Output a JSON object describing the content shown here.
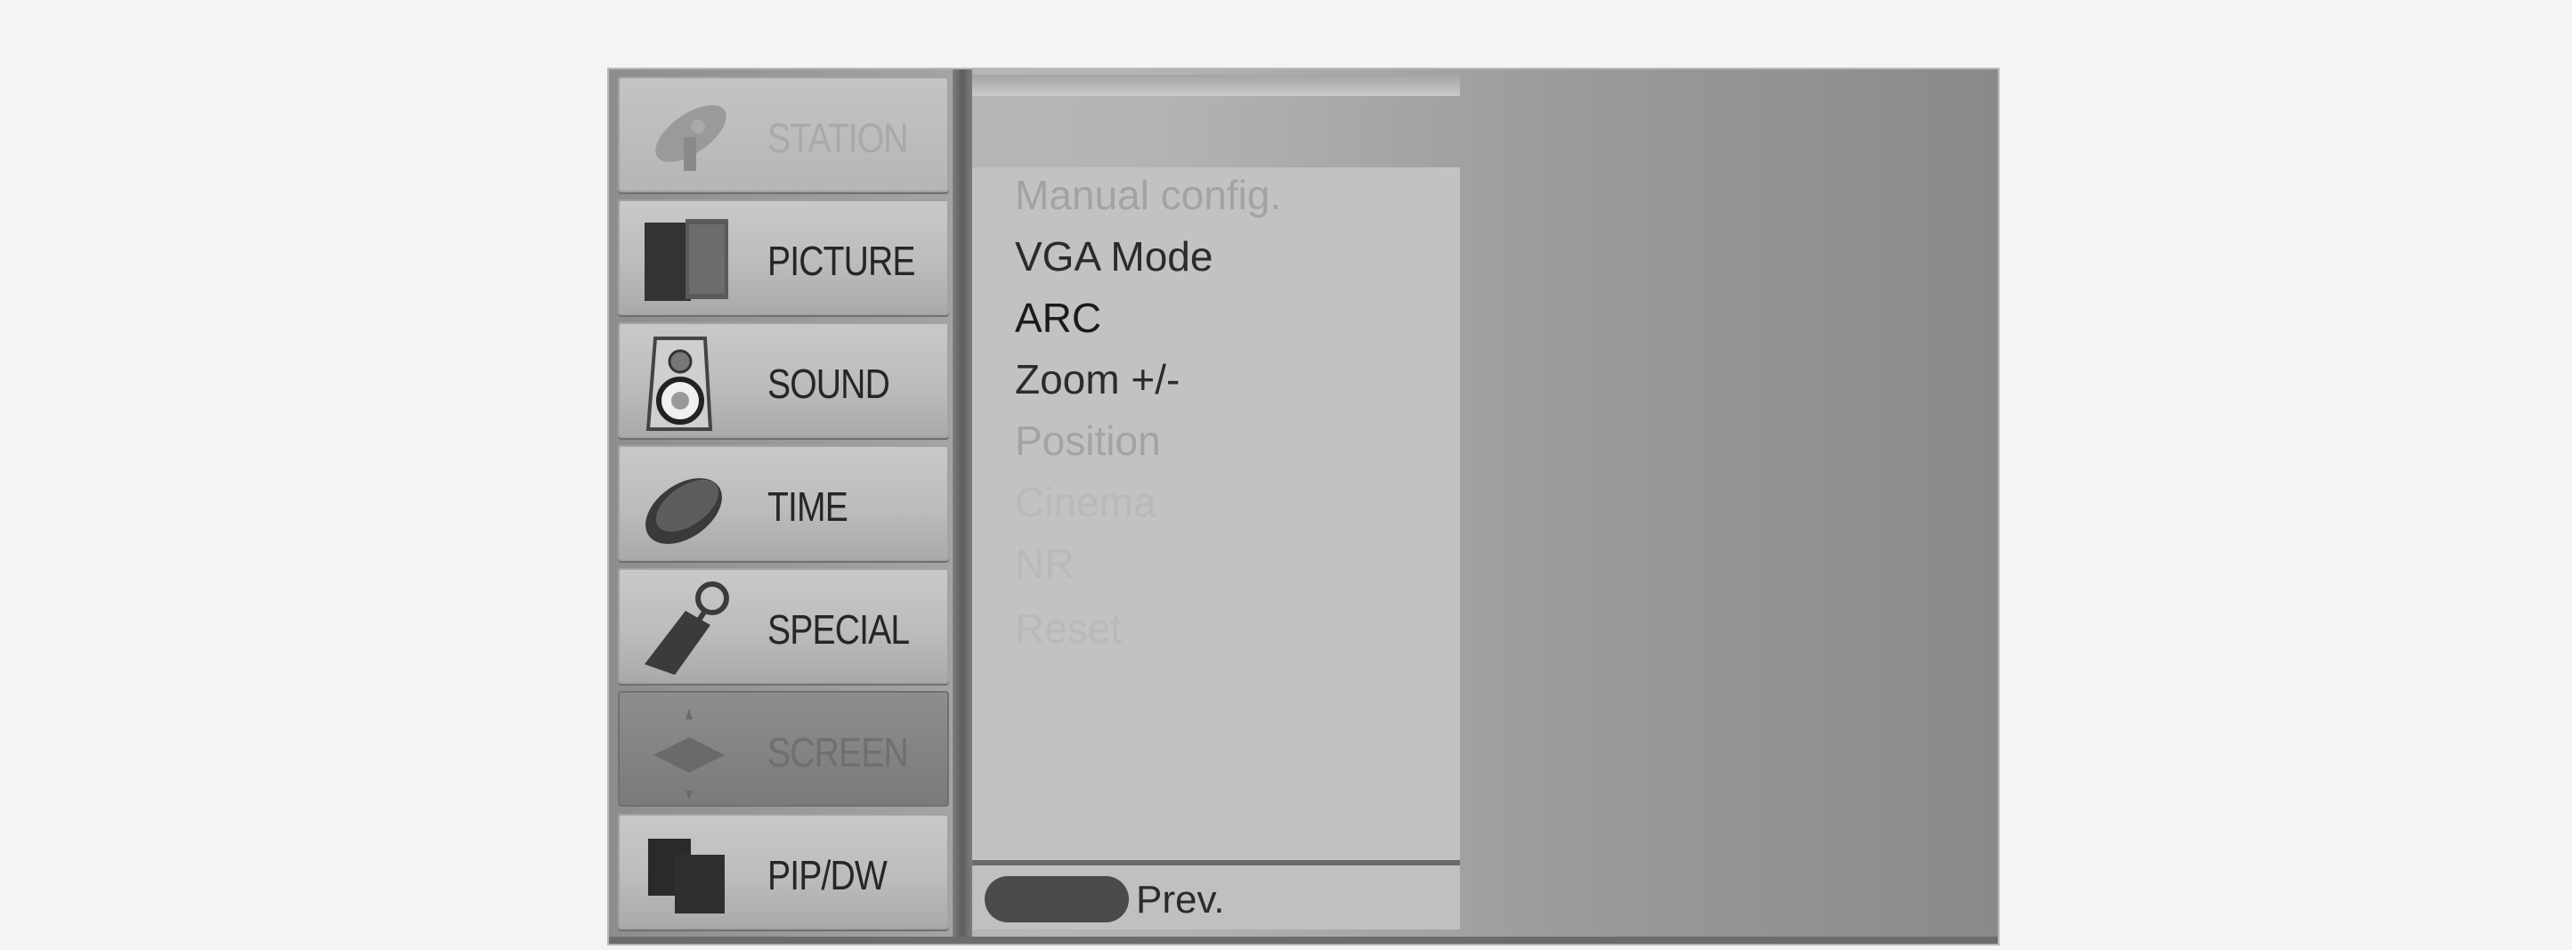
{
  "menu": {
    "items": [
      {
        "label": "STATION",
        "icon": "satellite-dish-icon"
      },
      {
        "label": "PICTURE",
        "icon": "picture-icon"
      },
      {
        "label": "SOUND",
        "icon": "speaker-icon"
      },
      {
        "label": "TIME",
        "icon": "clock-icon"
      },
      {
        "label": "SPECIAL",
        "icon": "tag-icon"
      },
      {
        "label": "SCREEN",
        "icon": "screen-arrows-icon"
      },
      {
        "label": "PIP/DW",
        "icon": "pip-icon"
      }
    ],
    "active": "SCREEN"
  },
  "submenu": {
    "items": [
      "Manual config.",
      "VGA Mode",
      "ARC",
      "Zoom +/-",
      "Position",
      "Cinema",
      "NR",
      "Reset"
    ],
    "selected": "ARC"
  },
  "footer": {
    "prev_label": "Prev."
  }
}
